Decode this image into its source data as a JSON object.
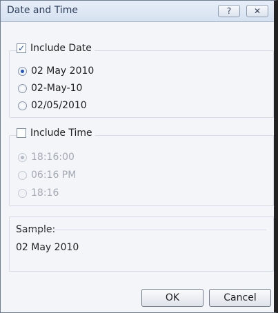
{
  "window": {
    "title": "Date and Time",
    "help_glyph": "?",
    "close_glyph": "✕"
  },
  "date_group": {
    "label": "Include Date",
    "checked": true,
    "options": [
      {
        "label": "02 May 2010",
        "selected": true
      },
      {
        "label": "02-May-10",
        "selected": false
      },
      {
        "label": "02/05/2010",
        "selected": false
      }
    ]
  },
  "time_group": {
    "label": "Include Time",
    "checked": false,
    "options": [
      {
        "label": "18:16:00",
        "selected": true,
        "disabled": true
      },
      {
        "label": "06:16 PM",
        "selected": false,
        "disabled": true
      },
      {
        "label": "18:16",
        "selected": false,
        "disabled": true
      }
    ]
  },
  "sample": {
    "label": "Sample:",
    "value": "02 May 2010"
  },
  "buttons": {
    "ok": "OK",
    "cancel": "Cancel"
  }
}
